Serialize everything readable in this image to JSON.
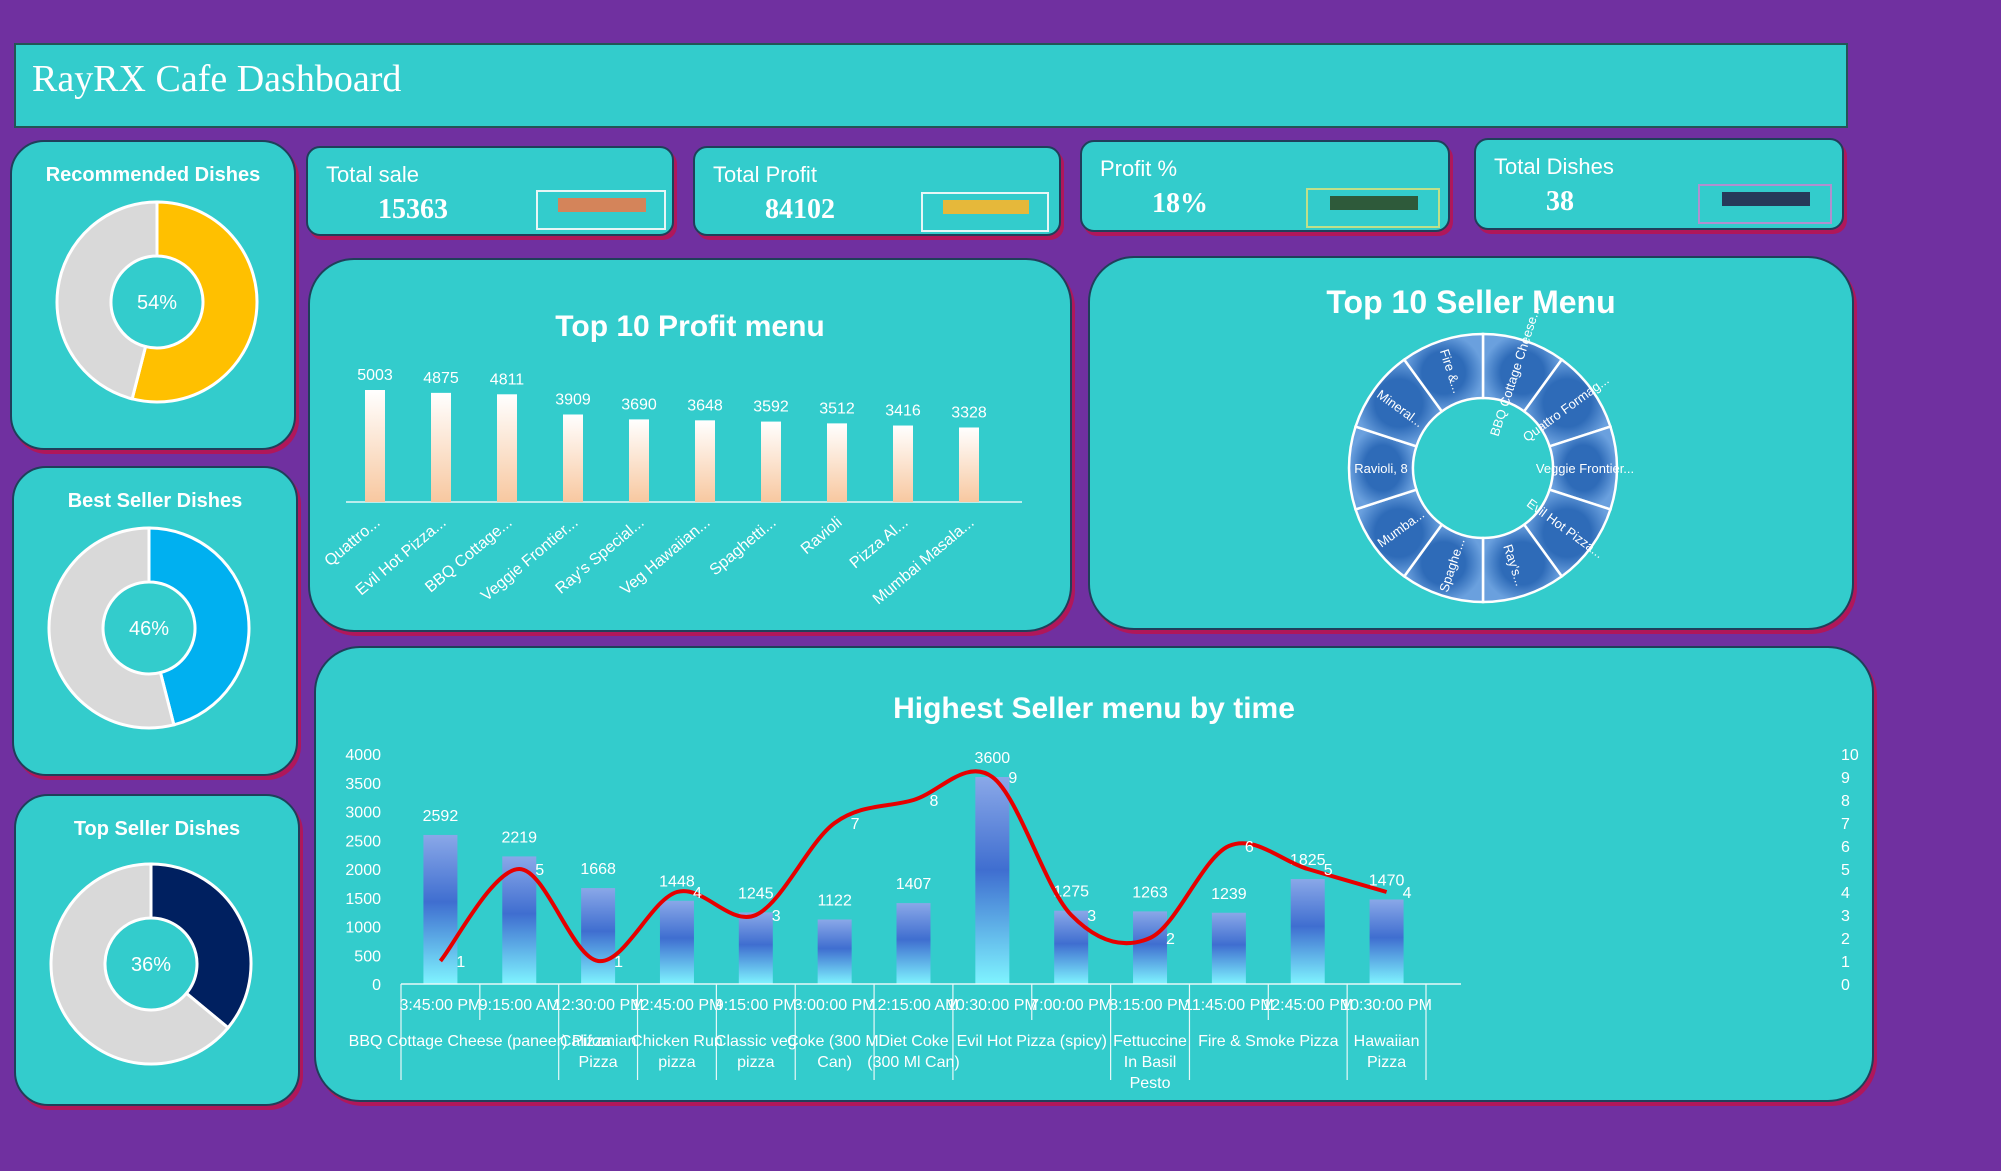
{
  "header": {
    "title": "RayRX Cafe Dashboard"
  },
  "kpis": [
    {
      "label": "Total sale",
      "value": "15363",
      "color": "#d4845a"
    },
    {
      "label": "Total Profit",
      "value": "84102",
      "color": "#e6b83a"
    },
    {
      "label": "Profit %",
      "value": "18%",
      "color": "#2e5a3a"
    },
    {
      "label": "Total Dishes",
      "value": "38",
      "color": "#263a5a"
    }
  ],
  "donuts": [
    {
      "title": "Recommended Dishes",
      "percent": 54,
      "label": "54%",
      "color": "#ffc000"
    },
    {
      "title": "Best Seller Dishes",
      "percent": 46,
      "label": "46%",
      "color": "#00b0f0"
    },
    {
      "title": "Top Seller Dishes",
      "percent": 36,
      "label": "36%",
      "color": "#002060"
    }
  ],
  "chart_data": [
    {
      "type": "pie",
      "title": "Recommended Dishes",
      "series": [
        {
          "values": [
            54,
            46
          ]
        }
      ],
      "data_labels": [
        "54%"
      ]
    },
    {
      "type": "pie",
      "title": "Best Seller Dishes",
      "series": [
        {
          "values": [
            46,
            54
          ]
        }
      ],
      "data_labels": [
        "46%"
      ]
    },
    {
      "type": "pie",
      "title": "Top Seller Dishes",
      "series": [
        {
          "values": [
            36,
            64
          ]
        }
      ],
      "data_labels": [
        "36%"
      ]
    },
    {
      "type": "bar",
      "title": "Top 10 Profit menu",
      "categories": [
        "Quattro...",
        "Evil Hot Pizza...",
        "BBQ Cottage...",
        "Veggie Frontier...",
        "Ray's Special...",
        "Veg Hawaiian...",
        "Spaghetti...",
        "Ravioli",
        "Pizza Al...",
        "Mumbai Masala..."
      ],
      "values": [
        5003,
        4875,
        4811,
        3909,
        3690,
        3648,
        3592,
        3512,
        3416,
        3328
      ],
      "ylim": [
        0,
        5500
      ]
    },
    {
      "type": "pie",
      "title": "Top 10 Seller Menu",
      "categories": [
        "BBQ Cottage Cheese...",
        "Quattro Formag...",
        "Veggie Frontier...",
        "Evil Hot Pizza...",
        "Ray's...",
        "Spaghe...",
        "Mumba...",
        "Ravioli, 8",
        "Mineral...",
        "Fire &..."
      ],
      "series": [
        {
          "values": [
            1,
            1,
            1,
            1,
            1,
            1,
            1,
            1,
            1,
            1
          ]
        }
      ]
    },
    {
      "type": "bar",
      "title": "Highest Seller menu by time",
      "times": [
        "3:45:00 PM",
        "9:15:00 AM",
        "12:30:00 PM",
        "12:45:00 PM",
        "9:15:00 PM",
        "3:00:00 PM",
        "12:15:00 AM",
        "10:30:00 PM",
        "7:00:00 PM",
        "8:15:00 PM",
        "11:45:00 PM",
        "12:45:00 PM",
        "10:30:00 PM"
      ],
      "groups": [
        {
          "name": "BBQ Cottage Cheese (paneer) Pizza",
          "span": 2
        },
        {
          "name": "Californian Pizza",
          "span": 1
        },
        {
          "name": "Chicken Run pizza",
          "span": 1
        },
        {
          "name": "Classic veg pizza",
          "span": 1
        },
        {
          "name": "Coke (300 Ml Can)",
          "span": 1
        },
        {
          "name": "Diet Coke (300 Ml Can)",
          "span": 1
        },
        {
          "name": "Evil Hot Pizza (spicy)",
          "span": 2
        },
        {
          "name": "Fettuccine In Basil Pesto",
          "span": 1
        },
        {
          "name": "Fire & Smoke Pizza",
          "span": 2
        },
        {
          "name": "Hawaiian Pizza",
          "span": 1
        }
      ],
      "series": [
        {
          "values": [
            2592,
            2219,
            1668,
            1448,
            1245,
            1122,
            1407,
            3600,
            1275,
            1263,
            1239,
            1825,
            1470
          ]
        },
        {
          "values": [
            1,
            5,
            1,
            4,
            3,
            7,
            8,
            9,
            3,
            2,
            6,
            5,
            4
          ],
          "type": "line"
        }
      ],
      "ylim": [
        0,
        4000
      ],
      "yticks": [
        0,
        500,
        1000,
        1500,
        2000,
        2500,
        3000,
        3500,
        4000
      ],
      "y2lim": [
        0,
        10
      ],
      "y2ticks": [
        0,
        1,
        2,
        3,
        4,
        5,
        6,
        7,
        8,
        9,
        10
      ]
    }
  ]
}
